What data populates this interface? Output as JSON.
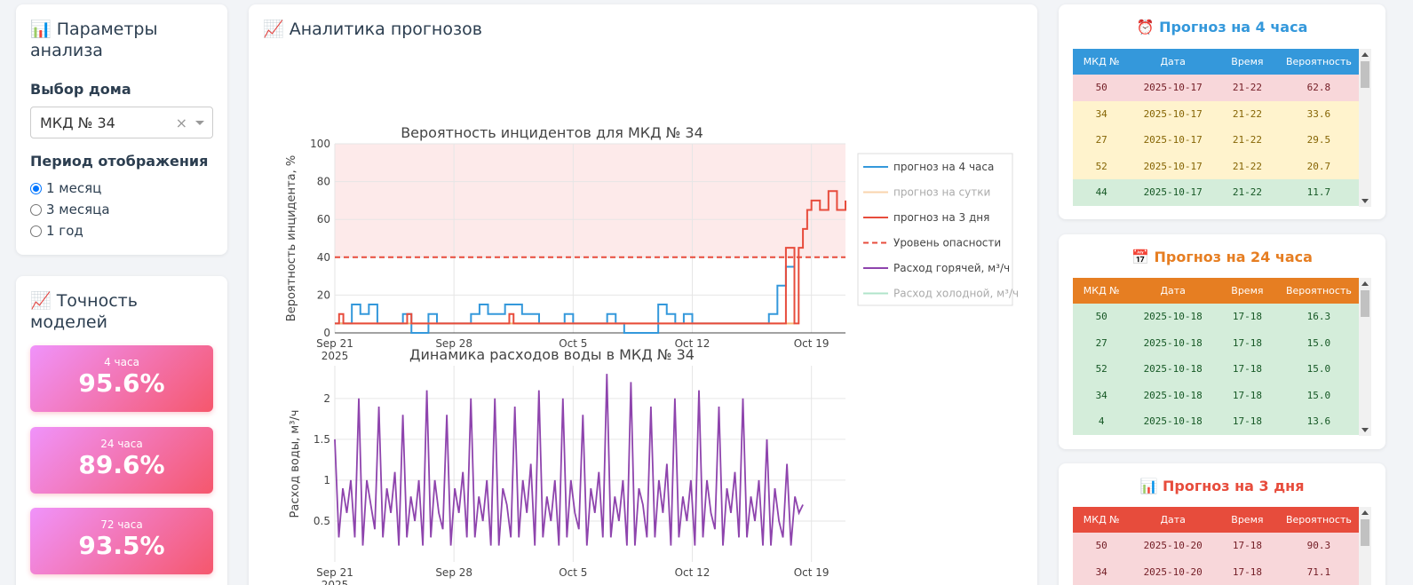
{
  "params": {
    "title": "📊 Параметры анализа",
    "house_label": "Выбор дома",
    "house_value": "МКД № 34",
    "clear_symbol": "×",
    "period_label": "Период отображения",
    "period_options": [
      "1 месяц",
      "3 месяца",
      "1 год"
    ],
    "period_selected": "1 месяц"
  },
  "accuracy": {
    "title": "📈 Точность моделей",
    "items": [
      {
        "label": "4 часа",
        "value": "95.6%"
      },
      {
        "label": "24 часа",
        "value": "89.6%"
      },
      {
        "label": "72 часа",
        "value": "93.5%"
      }
    ]
  },
  "analytics": {
    "title": "📈 Аналитика прогнозов"
  },
  "chart_data": [
    {
      "type": "line",
      "title": "Вероятность инцидентов для МКД № 34",
      "ylabel": "Вероятность инцидента, %",
      "xlabel": "",
      "ylim": [
        0,
        100
      ],
      "xlim": [
        "2025-09-21",
        "2025-10-21"
      ],
      "x_ticks": [
        "Sep 21",
        "Sep 28",
        "Oct 5",
        "Oct 12",
        "Oct 19"
      ],
      "x_year": "2025",
      "y_ticks": [
        0,
        20,
        40,
        60,
        80,
        100
      ],
      "danger_zone": [
        40,
        100
      ],
      "grid": true,
      "legend_position": "right",
      "legend": [
        "прогноз на 4 часа",
        "прогноз на сутки",
        "прогноз на 3 дня",
        "Уровень опасности",
        "Расход горячей, м³/ч",
        "Расход холодной, м³/ч"
      ],
      "series": [
        {
          "name": "прогноз на 4 часа",
          "color": "#3498db",
          "x": [
            "2025-09-21",
            "2025-09-21T12:00",
            "2025-09-22",
            "2025-09-22T12:00",
            "2025-09-23",
            "2025-09-23T12:00",
            "2025-09-24",
            "2025-09-25",
            "2025-09-25T12:00",
            "2025-09-26",
            "2025-09-26T12:00",
            "2025-09-27",
            "2025-09-28",
            "2025-09-29",
            "2025-09-29T12:00",
            "2025-09-30",
            "2025-10-01",
            "2025-10-02",
            "2025-10-03",
            "2025-10-04",
            "2025-10-04T12:00",
            "2025-10-05",
            "2025-10-06",
            "2025-10-07",
            "2025-10-07T12:00",
            "2025-10-08",
            "2025-10-09",
            "2025-10-10",
            "2025-10-10T12:00",
            "2025-10-11",
            "2025-10-11T12:00",
            "2025-10-12",
            "2025-10-13",
            "2025-10-14",
            "2025-10-15",
            "2025-10-16",
            "2025-10-16T12:00",
            "2025-10-17",
            "2025-10-17T12:00",
            "2025-10-18"
          ],
          "y": [
            5,
            5,
            15,
            10,
            15,
            5,
            5,
            10,
            0,
            0,
            10,
            5,
            5,
            10,
            15,
            10,
            15,
            10,
            5,
            5,
            10,
            5,
            5,
            10,
            5,
            0,
            0,
            15,
            10,
            5,
            10,
            5,
            5,
            5,
            5,
            5,
            10,
            25,
            35,
            30
          ]
        },
        {
          "name": "прогноз на сутки",
          "color": "#f8b878",
          "x": [
            "2025-09-21",
            "2025-10-18"
          ],
          "y": [
            5,
            5
          ]
        },
        {
          "name": "прогноз на 3 дня",
          "color": "#e74c3c",
          "x": [
            "2025-09-21",
            "2025-09-21T06:00",
            "2025-09-21T12:00",
            "2025-09-22",
            "2025-09-25",
            "2025-09-25T06:00",
            "2025-09-25T12:00",
            "2025-10-01",
            "2025-10-01T06:00",
            "2025-10-01T12:00",
            "2025-10-17",
            "2025-10-17T12:00",
            "2025-10-17T18:00",
            "2025-10-18",
            "2025-10-18T06:00",
            "2025-10-18T12:00",
            "2025-10-18T18:00",
            "2025-10-19",
            "2025-10-19T12:00",
            "2025-10-20",
            "2025-10-20T12:00",
            "2025-10-21"
          ],
          "y": [
            5,
            10,
            5,
            5,
            5,
            10,
            5,
            5,
            10,
            5,
            5,
            45,
            45,
            5,
            45,
            55,
            65,
            70,
            65,
            75,
            65,
            70
          ]
        },
        {
          "name": "Уровень опасности",
          "color": "#e74c3c",
          "x": [
            "2025-09-21",
            "2025-10-21"
          ],
          "y": [
            40,
            40
          ]
        }
      ]
    },
    {
      "type": "line",
      "title": "Динамика расходов воды в МКД № 34",
      "ylabel": "Расход воды, м³/ч",
      "xlabel": "",
      "ylim": [
        0,
        2.4
      ],
      "xlim": [
        "2025-09-21",
        "2025-10-21"
      ],
      "x_ticks": [
        "Sep 21",
        "Sep 28",
        "Oct 5",
        "Oct 12",
        "Oct 19"
      ],
      "x_year": "2025",
      "y_ticks": [
        0.5,
        1,
        1.5,
        2
      ],
      "grid": true,
      "series": [
        {
          "name": "Расход горячей, м³/ч",
          "color": "#8e44ad",
          "x_start": "2025-09-21",
          "x_end": "2025-10-18T12:00",
          "y": [
            1.5,
            0.3,
            0.9,
            0.6,
            1.0,
            0.3,
            2.0,
            0.2,
            1.0,
            0.7,
            0.4,
            1.9,
            0.3,
            0.9,
            0.6,
            1.1,
            0.2,
            1.8,
            0.3,
            0.8,
            0.5,
            1.0,
            0.2,
            2.1,
            0.3,
            1.0,
            0.6,
            0.4,
            1.8,
            0.2,
            0.9,
            0.6,
            1.1,
            0.3,
            2.0,
            0.3,
            0.8,
            0.5,
            1.0,
            0.2,
            2.0,
            0.2,
            0.9,
            0.7,
            0.3,
            1.9,
            0.3,
            1.0,
            0.6,
            1.2,
            0.2,
            2.1,
            0.3,
            0.8,
            0.5,
            1.0,
            0.2,
            2.0,
            0.3,
            1.0,
            0.6,
            0.4,
            1.8,
            0.2,
            0.9,
            0.6,
            1.1,
            0.3,
            2.3,
            0.3,
            0.8,
            0.5,
            1.0,
            0.2,
            2.2,
            0.2,
            0.9,
            0.7,
            0.3,
            1.9,
            0.3,
            1.0,
            0.6,
            1.2,
            0.2,
            2.0,
            0.3,
            0.8,
            0.5,
            1.0,
            0.2,
            2.1,
            0.3,
            1.0,
            0.6,
            0.4,
            1.9,
            0.2,
            0.9,
            0.6,
            1.1,
            0.3,
            2.0,
            0.3,
            0.8,
            0.5,
            1.0,
            0.2,
            1.5,
            0.2,
            0.9,
            0.5,
            0.3,
            1.2,
            0.2,
            0.8,
            0.6,
            0.7
          ]
        }
      ]
    }
  ],
  "forecast_4h": {
    "title": "⏰ Прогноз на 4 часа",
    "color": "#3498db",
    "columns": [
      "МКД №",
      "Дата",
      "Время",
      "Вероятность"
    ],
    "rows": [
      [
        "50",
        "2025-10-17",
        "21-22",
        "62.8"
      ],
      [
        "34",
        "2025-10-17",
        "21-22",
        "33.6"
      ],
      [
        "27",
        "2025-10-17",
        "21-22",
        "29.5"
      ],
      [
        "52",
        "2025-10-17",
        "21-22",
        "20.7"
      ],
      [
        "44",
        "2025-10-17",
        "21-22",
        "11.7"
      ]
    ]
  },
  "forecast_24h": {
    "title": "📅 Прогноз на 24 часа",
    "color": "#e67e22",
    "columns": [
      "МКД №",
      "Дата",
      "Время",
      "Вероятность"
    ],
    "rows": [
      [
        "50",
        "2025-10-18",
        "17-18",
        "16.3"
      ],
      [
        "27",
        "2025-10-18",
        "17-18",
        "15.0"
      ],
      [
        "52",
        "2025-10-18",
        "17-18",
        "15.0"
      ],
      [
        "34",
        "2025-10-18",
        "17-18",
        "15.0"
      ],
      [
        "4",
        "2025-10-18",
        "17-18",
        "13.6"
      ]
    ]
  },
  "forecast_3d": {
    "title": "📊 Прогноз на 3 дня",
    "color": "#e74c3c",
    "columns": [
      "МКД №",
      "Дата",
      "Время",
      "Вероятность"
    ],
    "rows": [
      [
        "50",
        "2025-10-20",
        "17-18",
        "90.3"
      ],
      [
        "34",
        "2025-10-20",
        "17-18",
        "71.1"
      ]
    ]
  },
  "row_colors": {
    "high_bg": "#f8d7da",
    "high_fg": "#721c24",
    "mid_bg": "#fff3cd",
    "mid_fg": "#856404",
    "low_bg": "#d4edda",
    "low_fg": "#155724"
  }
}
